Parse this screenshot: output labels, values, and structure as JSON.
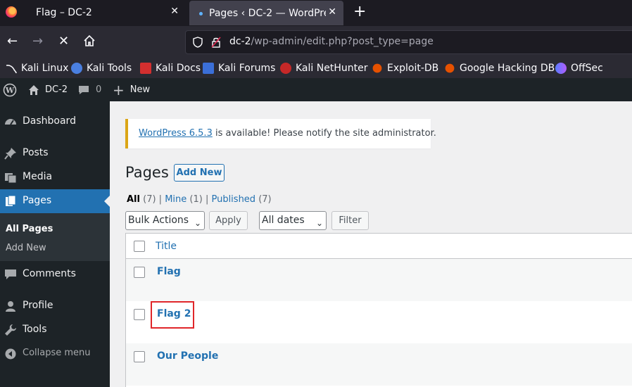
{
  "browser": {
    "tabs": [
      {
        "title": "Flag – DC-2",
        "active": false
      },
      {
        "title": "Pages ‹ DC-2 — WordPress",
        "active": true
      }
    ],
    "url": {
      "host": "dc-2",
      "path": "/wp-admin/edit.php?post_type=page"
    },
    "bookmarks": [
      "Kali Linux",
      "Kali Tools",
      "Kali Docs",
      "Kali Forums",
      "Kali NetHunter",
      "Exploit-DB",
      "Google Hacking DB",
      "OffSec"
    ]
  },
  "adminbar": {
    "site_name": "DC-2",
    "comments_count": "0",
    "new_label": "New"
  },
  "sidebar": {
    "items": [
      {
        "label": "Dashboard",
        "icon": "dashboard-icon"
      },
      {
        "label": "Posts",
        "icon": "pin-icon"
      },
      {
        "label": "Media",
        "icon": "media-icon"
      },
      {
        "label": "Pages",
        "icon": "pages-icon"
      },
      {
        "label": "Comments",
        "icon": "comment-icon"
      },
      {
        "label": "Profile",
        "icon": "user-icon"
      },
      {
        "label": "Tools",
        "icon": "wrench-icon"
      },
      {
        "label": "Collapse menu",
        "icon": "collapse-icon"
      }
    ],
    "submenu": [
      "All Pages",
      "Add New"
    ]
  },
  "notice": {
    "link": "WordPress 6.5.3",
    "text": " is available! Please notify the site administrator."
  },
  "main": {
    "title": "Pages",
    "add_new": "Add New",
    "filters": {
      "all": "All",
      "all_count": " (7)",
      "sep": " | ",
      "mine": "Mine",
      "mine_count": " (1)",
      "published": "Published",
      "published_count": " (7)"
    },
    "bulk_actions": "Bulk Actions",
    "apply": "Apply",
    "all_dates": "All dates",
    "filter": "Filter",
    "column_title": "Title",
    "rows": [
      "Flag",
      "Flag 2",
      "Our People"
    ]
  },
  "colors": {
    "accent": "#2271b1",
    "highlight": "#e0262a",
    "notice_border": "#dba617"
  }
}
